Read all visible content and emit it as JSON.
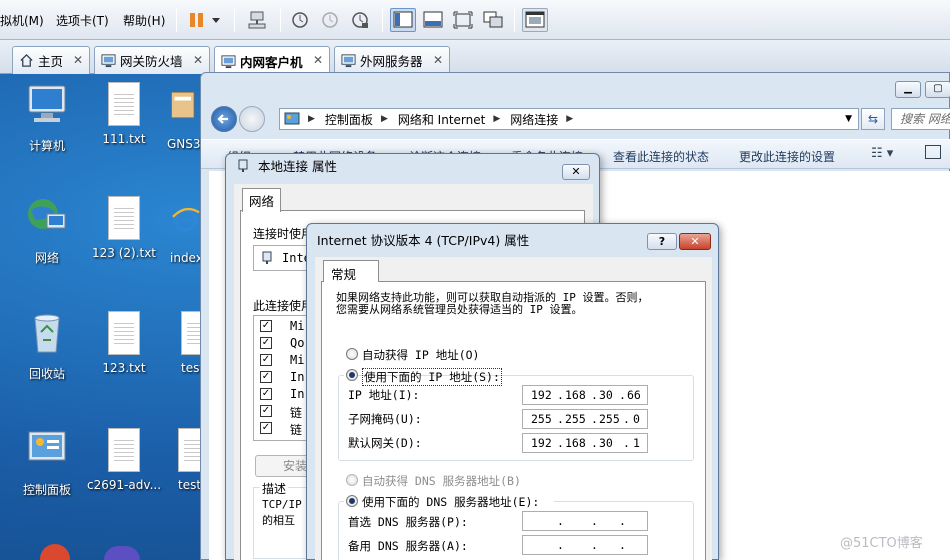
{
  "menubar": {
    "menus": [
      "拟机(M)",
      "选项卡(T)",
      "帮助(H)"
    ]
  },
  "tabs": [
    {
      "label": "主页",
      "icon": "home-icon"
    },
    {
      "label": "网关防火墙",
      "icon": "vm-icon"
    },
    {
      "label": "内网客户机",
      "icon": "vm-icon"
    },
    {
      "label": "外网服务器",
      "icon": "vm-icon"
    }
  ],
  "desktop": {
    "icons": [
      {
        "label": "计算机",
        "icon": "computer-icon"
      },
      {
        "label": "111.txt",
        "icon": "text-file-icon"
      },
      {
        "label": "GNS3",
        "icon": "gns3-icon"
      },
      {
        "label": "网络",
        "icon": "network-icon"
      },
      {
        "label": "123 (2).txt",
        "icon": "text-file-icon"
      },
      {
        "label": "index",
        "icon": "ie-icon"
      },
      {
        "label": "回收站",
        "icon": "recycle-bin-icon"
      },
      {
        "label": "123.txt",
        "icon": "text-file-icon"
      },
      {
        "label": "test",
        "icon": "text-file-icon"
      },
      {
        "label": "控制面板",
        "icon": "control-panel-icon"
      },
      {
        "label": "c2691-adv...",
        "icon": "file-icon"
      },
      {
        "label": "test",
        "icon": "text-file-icon"
      }
    ]
  },
  "explorer": {
    "breadcrumbs": [
      "控制面板",
      "网络和 Internet",
      "网络连接"
    ],
    "search_placeholder": "搜索 网络",
    "commands": [
      "组织 ▼",
      "禁用此网络设备",
      "诊断这个连接",
      "重命名此连接",
      "查看此连接的状态",
      "更改此连接的设置"
    ]
  },
  "props_dialog": {
    "title": "本地连接 属性",
    "tab": "网络",
    "connect_using": "连接时使用",
    "adapter": "Inte",
    "items_label": "此连接使用",
    "items": [
      "Mi",
      "Qo",
      "Mi",
      "In",
      "In",
      "链",
      "链"
    ],
    "install_button": "安装",
    "desc_label": "描述",
    "desc_lines": [
      "TCP/IP",
      "的相互"
    ]
  },
  "ipv4_dialog": {
    "title": "Internet 协议版本 4 (TCP/IPv4) 属性",
    "tab": "常规",
    "intro_lines": [
      "如果网络支持此功能，则可以获取自动指派的 IP 设置。否则，",
      "您需要从网络系统管理员处获得适当的 IP 设置。"
    ],
    "auto_ip": "自动获得 IP 地址(O)",
    "manual_ip": "使用下面的 IP 地址(S):",
    "ip_label": "IP 地址(I):",
    "ip_value": [
      "192",
      "168",
      "30",
      "66"
    ],
    "mask_label": "子网掩码(U):",
    "mask_value": [
      "255",
      "255",
      "255",
      "0"
    ],
    "gateway_label": "默认网关(D):",
    "gateway_value": [
      "192",
      "168",
      "30",
      "1"
    ],
    "auto_dns": "自动获得 DNS 服务器地址(B)",
    "manual_dns": "使用下面的 DNS 服务器地址(E):",
    "dns1_label": "首选 DNS 服务器(P):",
    "dns2_label": "备用 DNS 服务器(A):"
  },
  "watermark": "@51CTO博客"
}
